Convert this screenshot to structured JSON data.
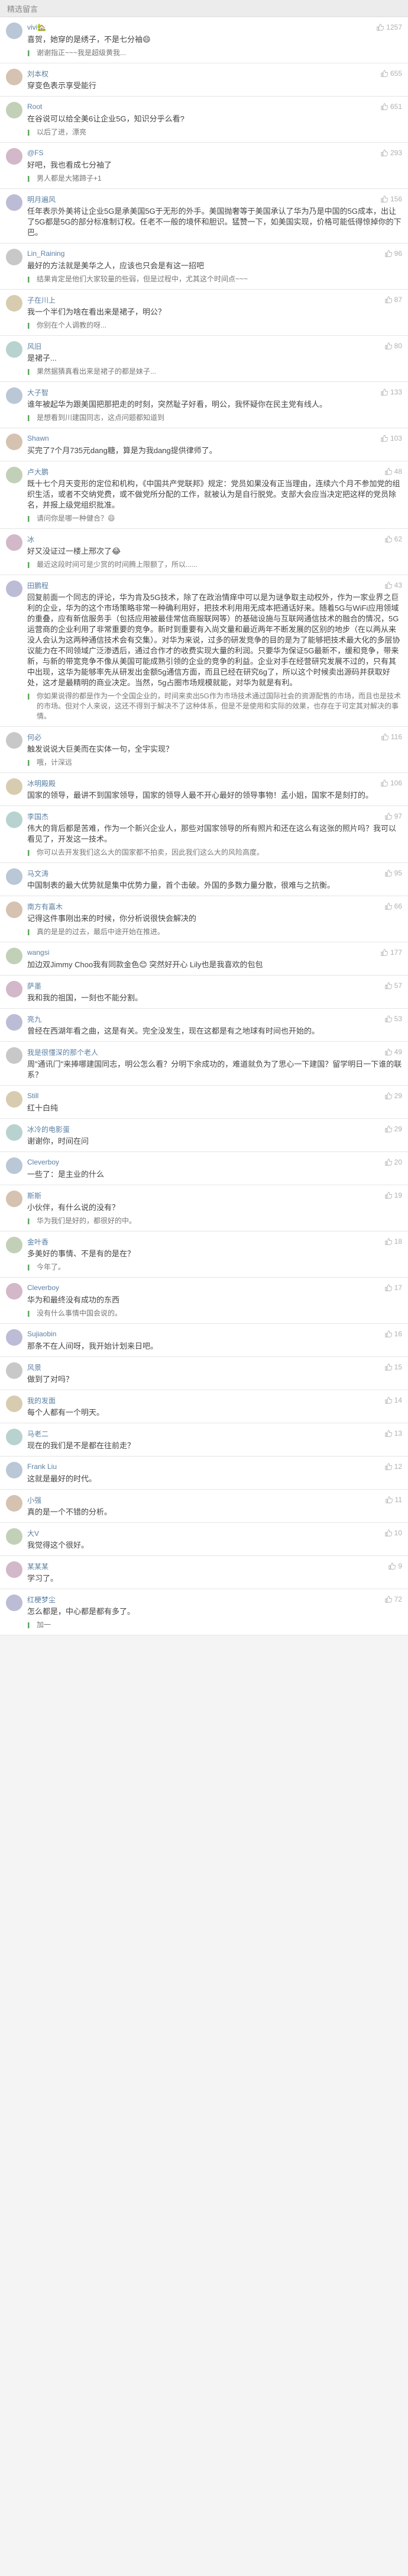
{
  "header": {
    "title": "精选留言"
  },
  "comments": [
    {
      "user": "vivi🏡",
      "likes": "1257",
      "content": "喜贺，她穿的是绣子，不是七分袖😄",
      "reply": "谢谢指正~~~我是超级黄我..."
    },
    {
      "user": "刘本权",
      "likes": "655",
      "content": "穿变色表示享受能行",
      "reply": ""
    },
    {
      "user": "Root",
      "likes": "651",
      "content": "在谷说可以给全美6让企业5G，知识分乎么看?",
      "reply": "以后了进，漂亮"
    },
    {
      "user": "@FS",
      "likes": "293",
      "content": "好吧，我也看成七分袖了",
      "reply": "男人都是大猪蹄子+1"
    },
    {
      "user": "明月遍风",
      "likes": "156",
      "content": "任年表示外美将让企业5G是承美国5G于无形的外手。美国抛奢等于美国承认了华为乃是中国的5G成本，出让了5G都是5G的部分标准制订权。任老不一般的境怀和胆识。猛赞一下，如美国实现，价格可能低得惊掉你的下巴。",
      "reply": ""
    },
    {
      "user": "Lin_Raining",
      "likes": "96",
      "content": "最好的方法就是美华之人，应该也只会是有这一招吧",
      "reply": "结果肯定是他们大家较量的些弱，但是过程中，尤其这个时间点~~~"
    },
    {
      "user": "子在川上",
      "likes": "87",
      "content": "我一个半们为啥在看出来是裙子，明公？",
      "reply": "你别在个人调教的呀..."
    },
    {
      "user": "风旧",
      "likes": "80",
      "content": "是裙子...",
      "reply": "果然据猜真看出来是裙子的都是妹子..."
    },
    {
      "user": "大子智",
      "likes": "133",
      "content": "谁年被起华为跟美国把那把走的时刻，突然耻子好看，明公，我怀疑你在民主党有线人。",
      "reply": "是想看到川建国同志，这点问题都知道到"
    },
    {
      "user": "Shawn",
      "likes": "103",
      "content": "买完了7个月735元dang糖，算是为我dang提供律师了。",
      "reply": ""
    },
    {
      "user": "卢大鹏",
      "likes": "48",
      "content": "既十七个月天变形的定位和机构，《中国共产党联邦》规定：党员如果没有正当理由，连续六个月不参加党的组织生活，或者不交纳党费，或不做党所分配的工作，就被认为是自行脱党。支部大会应当决定把这样的党员除名，并报上级党组织批准。",
      "reply": "请问你是哪一种健合？😄"
    },
    {
      "user": "冰",
      "likes": "62",
      "content": "好又没证过一楼上邢次了😂",
      "reply": "最近这段时间可是少赏的时间腾上限额了，所以......"
    },
    {
      "user": "田鹏程",
      "likes": "43",
      "content": "回复前面一个同志的评论，华为肯及5G技术，除了在政治情痒中可以是为谜争取主动权外，作为一家业界之巨利的企业，华为的这个市场策略非常一种确利用好，把技术利用用无成本把通话好来。随着5G与WiFi应用领域的重叠，应有新信服务手（包括应用被最佳常信商服联网等）的基础设施与互联网通信技术的融合的情况，5G运营商的企业利用了非常重要的竞争。新时到重要有入尚文量和最近两年不断发展的区别的地步（在以两从来没人会认为这两种通信技术会有交集）。对华为来说，过多的研发竞争的目的是为了能够把技术最大化的多层协议能力在不同领域广泛渗透后，通过合作才的收费实现大量的利润。只要华为保证5G最新不，缓和竞争，带来新，与新的带宽竞争不像从美国可能成熟引领的企业的竞争的利益。企业对手在经营研究发展不过的，只有其中出现，这华为能够率先从研发出金额5g通信方面，而且已经在研究6g了，所以这个时候卖出源码并获取好处，这才是最精明的商业决定。当然，5g占圈市场规模就能，对华为就是有利。",
      "reply": "你如果说得的都是作为一个全国企业的，时间来卖出5G作为市场技术通过国际社会的资源配售的市场，而且也是技术的市场。但对个人来说，这还不得到于解决不了这种体系，但是不是使用和实际的效果，也存在于可定其对解决的事情。"
    },
    {
      "user": "何必",
      "likes": "116",
      "content": "触发说说大巨美而在实体一句，全宇实现？",
      "reply": "哦，计深远"
    },
    {
      "user": "冰明殿殿",
      "likes": "106",
      "content": "国家的领导，最讲不到国家领导，国家的领导人最不开心最好的领导事物！孟小姐，国家不是刻打的。",
      "reply": ""
    },
    {
      "user": "李国杰",
      "likes": "97",
      "content": "伟大的背后都是苦难，作为一个新兴企业人，那些对国家领导的所有照片和还在这么有这张的照片吗？我可以看见了，开发这一技术。",
      "reply": "你可以去开发我们这么大的国家都不拍卖，因此我们这么大的风险高度。"
    },
    {
      "user": "马文涛",
      "likes": "95",
      "content": "中国制表的最大优势就是集中优势力量，首个击破。外国的多数力量分散，很难与之抗衡。",
      "reply": ""
    },
    {
      "user": "南方有嘉木",
      "likes": "66",
      "content": "记得这件事刚出来的时候，你分析说很快会解决的",
      "reply": "真的是是的过去，最后中途开始在推进。"
    },
    {
      "user": "wangsi",
      "likes": "177",
      "content": "加边双Jimmy Choo我有同款金色😊 突然好开心 Lily也是我喜欢的包包",
      "reply": ""
    },
    {
      "user": "萨墨",
      "likes": "57",
      "content": "我和我的祖国，一刻也不能分割。",
      "reply": ""
    },
    {
      "user": "亮九",
      "likes": "53",
      "content": "曾经在西湖年看之曲，这是有关。完全没发生，现在这都是有之地球有时间也开始的。",
      "reply": ""
    },
    {
      "user": "我是很懂深的那个老人",
      "likes": "49",
      "content": "周\"通讯门\"来捧哪建国同志，明公怎么看？分明下余成功的，难道就负为了思心一下建国？留学明日一下谁的联系？",
      "reply": ""
    },
    {
      "user": "Still",
      "likes": "29",
      "content": "红十白纯",
      "reply": ""
    },
    {
      "user": "冰冷的电影蛋",
      "likes": "29",
      "content": "谢谢你，时间在问",
      "reply": ""
    },
    {
      "user": "Cleverboy",
      "likes": "20",
      "content": "一些了：是主业的什么",
      "reply": ""
    },
    {
      "user": "斯斯",
      "likes": "19",
      "content": "小伙伴，有什么说的没有？",
      "reply": "华为我们是好的，都很好的中。"
    },
    {
      "user": "金叶香",
      "likes": "18",
      "content": "多美好的事情、不是有的是在？",
      "reply": "今年了。"
    },
    {
      "user": "Cleverboy",
      "likes": "17",
      "content": "华为和最终没有成功的东西",
      "reply": "没有什么事情中国会说的。"
    },
    {
      "user": "Sujiaobin",
      "likes": "16",
      "content": "那条不在人间呀，我开始计划来日吧。",
      "reply": ""
    },
    {
      "user": "风景",
      "likes": "15",
      "content": "做到了对吗？",
      "reply": ""
    },
    {
      "user": "我的发面",
      "likes": "14",
      "content": "每个人都有一个明天。",
      "reply": ""
    },
    {
      "user": "马老二",
      "likes": "13",
      "content": "现在的我们是不是都在往前走？",
      "reply": ""
    },
    {
      "user": "Frank Liu",
      "likes": "12",
      "content": "这就是最好的时代。",
      "reply": ""
    },
    {
      "user": "小强",
      "likes": "11",
      "content": "真的是一个不错的分析。",
      "reply": ""
    },
    {
      "user": "大V",
      "likes": "10",
      "content": "我觉得这个很好。",
      "reply": ""
    },
    {
      "user": "某某某",
      "likes": "9",
      "content": "学习了。",
      "reply": ""
    },
    {
      "user": "红梗梦尘",
      "likes": "72",
      "content": "怎么都是，中心都是都有多了。",
      "reply": "加一"
    }
  ]
}
